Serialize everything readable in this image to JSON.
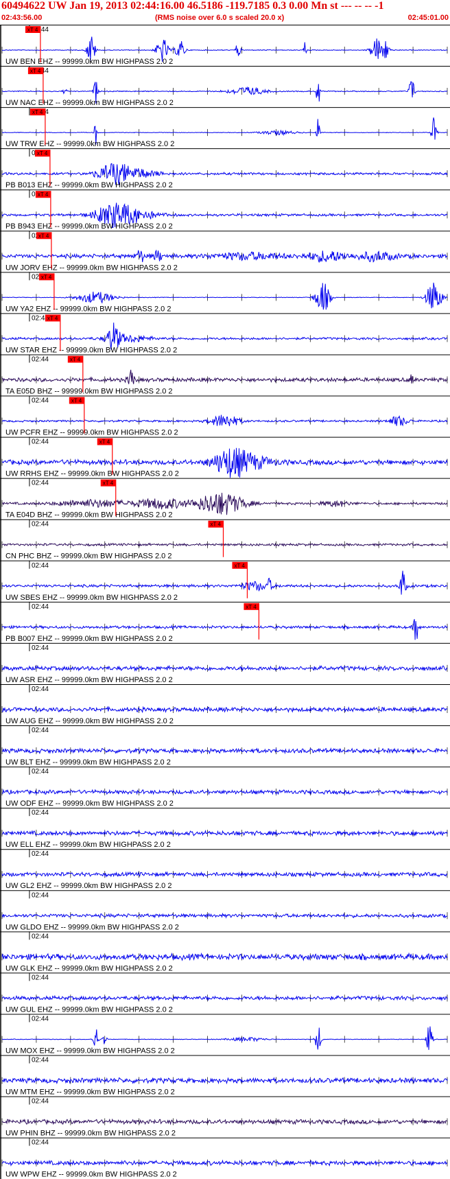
{
  "header": {
    "title": "60494622 UW Jan 19, 2013 02:44:16.00   46.5186 -119.7185  0.3 0.00 Mn st --- -- --   -1",
    "start_time": "02:43:56.00",
    "rms_note": "(RMS noise over 6.0 s scaled 20.0 x)",
    "end_time": "02:45:01.00"
  },
  "colors": {
    "trace_blue": "#0000ee",
    "trace_dark": "#2a0a5a",
    "pick_red": "#ff0000",
    "header_red": "#e00000"
  },
  "chart_data": {
    "type": "line",
    "title": "60494622 UW Jan 19, 2013 02:44:16.00   46.5186 -119.7185  0.3 0.00 Mn st --- -- --   -1",
    "xlim": [
      "02:43:56.00",
      "02:45:01.00"
    ],
    "time_label": "02:44",
    "pick_label": "xT 4",
    "grid": false,
    "traces": [
      {
        "label": "UW BEN EHZ -- 99999.0km BW  HIGHPASS  2.0  2",
        "pick": "02:44:01.6",
        "color": "blue",
        "noise": 0.04,
        "bursts": [
          [
            0.2,
            2.0,
            0.8
          ],
          [
            0.36,
            1.6,
            1.2
          ],
          [
            0.4,
            1.2,
            1.0
          ],
          [
            0.53,
            1.0,
            0.5
          ],
          [
            0.68,
            1.1,
            0.3
          ],
          [
            0.84,
            1.5,
            1.2
          ],
          [
            0.86,
            1.2,
            1.0
          ]
        ]
      },
      {
        "label": "UW NAC EHZ -- 99999.0km BW  HIGHPASS  2.0  2",
        "pick": "02:44:02.0",
        "color": "blue",
        "noise": 0.05,
        "bursts": [
          [
            0.14,
            0.3,
            0.5
          ],
          [
            0.21,
            1.6,
            0.4
          ],
          [
            0.55,
            0.5,
            4.0
          ],
          [
            0.71,
            2.2,
            0.4
          ],
          [
            0.92,
            2.3,
            0.5
          ]
        ]
      },
      {
        "label": "UW TRW EHZ -- 99999.0km BW  HIGHPASS  2.0  2",
        "pick": "02:44:02.3",
        "color": "blue",
        "noise": 0.03,
        "bursts": [
          [
            0.21,
            1.6,
            0.3
          ],
          [
            0.62,
            0.25,
            4.0
          ],
          [
            0.71,
            2.2,
            0.3
          ],
          [
            0.97,
            2.5,
            0.5
          ]
        ]
      },
      {
        "label": "PB B013 EHZ -- 99999.0km BW  HIGHPASS  2.0  2",
        "pick": "02:44:03.0",
        "color": "blue",
        "noise": 0.12,
        "bursts": [
          [
            0.25,
            1.1,
            3.5
          ],
          [
            0.3,
            0.5,
            5.0
          ]
        ]
      },
      {
        "label": "PB B943 EHZ -- 99999.0km BW  HIGHPASS  2.0  2",
        "pick": "02:44:03.1",
        "color": "blue",
        "noise": 0.12,
        "bursts": [
          [
            0.25,
            1.3,
            4.0
          ],
          [
            0.3,
            0.6,
            5.0
          ]
        ]
      },
      {
        "label": "UW JORV EHZ -- 99999.0km BW  HIGHPASS  2.0  2",
        "pick": "02:44:03.2",
        "color": "blue",
        "noise": 0.2,
        "bursts": [
          [
            0.31,
            0.7,
            1.0
          ],
          [
            0.35,
            0.6,
            1.0
          ],
          [
            0.55,
            0.35,
            8.0
          ],
          [
            0.73,
            0.6,
            4.0
          ],
          [
            0.84,
            0.5,
            4.0
          ]
        ]
      },
      {
        "label": "UW YA2 EHZ -- 99999.0km BW  HIGHPASS  2.0  2",
        "pick": "02:44:03.6",
        "color": "blue",
        "noise": 0.03,
        "bursts": [
          [
            0.21,
            0.7,
            4.0
          ],
          [
            0.72,
            2.0,
            1.5
          ],
          [
            0.97,
            2.0,
            1.6
          ]
        ]
      },
      {
        "label": "UW STAR EHZ -- 99999.0km BW  HIGHPASS  2.0  2",
        "pick": "02:44:04.5",
        "color": "blue",
        "noise": 0.12,
        "bursts": [
          [
            0.25,
            1.6,
            1.2
          ],
          [
            0.28,
            0.4,
            5.0
          ]
        ]
      },
      {
        "label": "TA E05D BHZ -- 99999.0km BW  HIGHPASS  2.0  2",
        "pick": "02:44:07.8",
        "color": "dark",
        "noise": 0.2,
        "bursts": [
          [
            0.29,
            1.4,
            0.6
          ],
          [
            0.92,
            0.5,
            0.5
          ]
        ]
      },
      {
        "label": "UW PCFR EHZ -- 99999.0km BW  HIGHPASS  2.0  2",
        "pick": "02:44:08.0",
        "color": "blue",
        "noise": 0.1,
        "bursts": [
          [
            0.5,
            0.8,
            3.0
          ],
          [
            0.89,
            0.6,
            2.0
          ]
        ]
      },
      {
        "label": "UW RRHS EHZ -- 99999.0km BW  HIGHPASS  2.0  2",
        "pick": "02:44:12.1",
        "color": "blue",
        "noise": 0.25,
        "bursts": [
          [
            0.51,
            1.3,
            3.5
          ],
          [
            0.55,
            0.8,
            5.0
          ]
        ]
      },
      {
        "label": "TA E04D BHZ -- 99999.0km BW  HIGHPASS  2.0  2",
        "pick": "02:44:12.6",
        "color": "dark",
        "noise": 0.12,
        "bursts": [
          [
            0.21,
            0.4,
            8.0
          ],
          [
            0.36,
            0.6,
            5.0
          ],
          [
            0.49,
            1.4,
            5.0
          ],
          [
            0.75,
            0.3,
            3.0
          ]
        ]
      },
      {
        "label": "CN PHC BHZ -- 99999.0km BW  HIGHPASS  2.0  2",
        "pick": "02:44:28.3",
        "color": "dark",
        "noise": 0.12,
        "bursts": []
      },
      {
        "label": "UW SBES EHZ -- 99999.0km BW  HIGHPASS  2.0  2",
        "pick": "02:44:31.8",
        "color": "blue",
        "noise": 0.14,
        "bursts": [
          [
            0.57,
            0.5,
            3.0
          ],
          [
            0.6,
            0.7,
            0.5
          ],
          [
            0.9,
            2.0,
            0.6
          ]
        ]
      },
      {
        "label": "PB B007 EHZ -- 99999.0km BW  HIGHPASS  2.0  2",
        "pick": "02:44:33.5",
        "color": "blue",
        "noise": 0.14,
        "bursts": [
          [
            0.93,
            2.0,
            0.5
          ]
        ]
      },
      {
        "label": "UW ASR EHZ -- 99999.0km BW  HIGHPASS  2.0  2",
        "pick": null,
        "color": "blue",
        "noise": 0.22,
        "bursts": []
      },
      {
        "label": "UW AUG EHZ -- 99999.0km BW  HIGHPASS  2.0  2",
        "pick": null,
        "color": "blue",
        "noise": 0.22,
        "bursts": []
      },
      {
        "label": "UW BLT EHZ -- 99999.0km BW  HIGHPASS  2.0  2",
        "pick": null,
        "color": "blue",
        "noise": 0.22,
        "bursts": []
      },
      {
        "label": "UW ODF EHZ -- 99999.0km BW  HIGHPASS  2.0  2",
        "pick": null,
        "color": "blue",
        "noise": 0.2,
        "bursts": []
      },
      {
        "label": "UW ELL EHZ -- 99999.0km BW  HIGHPASS  2.0  2",
        "pick": null,
        "color": "blue",
        "noise": 0.22,
        "bursts": []
      },
      {
        "label": "UW GL2 EHZ -- 99999.0km BW  HIGHPASS  2.0  2",
        "pick": null,
        "color": "blue",
        "noise": 0.2,
        "bursts": []
      },
      {
        "label": "UW GLDO EHZ -- 99999.0km BW  HIGHPASS  2.0  2",
        "pick": null,
        "color": "blue",
        "noise": 0.18,
        "bursts": []
      },
      {
        "label": "UW GLK EHZ -- 99999.0km BW  HIGHPASS  2.0  2",
        "pick": null,
        "color": "blue",
        "noise": 0.3,
        "bursts": []
      },
      {
        "label": "UW GUL EHZ -- 99999.0km BW  HIGHPASS  2.0  2",
        "pick": null,
        "color": "blue",
        "noise": 0.2,
        "bursts": []
      },
      {
        "label": "UW MOX EHZ -- 99999.0km BW  HIGHPASS  2.0  2",
        "pick": null,
        "color": "blue",
        "noise": 0.03,
        "bursts": [
          [
            0.21,
            1.8,
            0.5
          ],
          [
            0.23,
            0.8,
            0.4
          ],
          [
            0.55,
            0.25,
            4.0
          ],
          [
            0.71,
            1.7,
            0.6
          ],
          [
            0.96,
            1.9,
            0.6
          ]
        ]
      },
      {
        "label": "UW MTM EHZ -- 99999.0km BW  HIGHPASS  2.0  2",
        "pick": null,
        "color": "blue",
        "noise": 0.25,
        "bursts": []
      },
      {
        "label": "UW PHIN BHZ -- 99999.0km BW  HIGHPASS  2.0  2",
        "pick": null,
        "color": "dark",
        "noise": 0.22,
        "bursts": []
      },
      {
        "label": "UW WPW EHZ -- 99999.0km BW  HIGHPASS  2.0  2",
        "pick": null,
        "color": "blue",
        "noise": 0.22,
        "bursts": []
      }
    ]
  }
}
